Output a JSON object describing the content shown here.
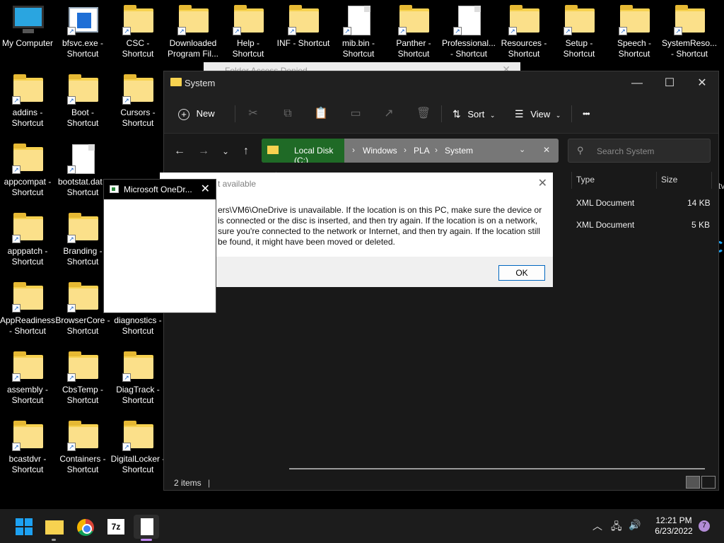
{
  "desktop": {
    "icons": [
      {
        "label": "My Computer",
        "type": "monitor"
      },
      {
        "label": "bfsvc.exe - Shortcut",
        "type": "exe"
      },
      {
        "label": "CSC - Shortcut",
        "type": "folder"
      },
      {
        "label": "Downloaded Program Fil...",
        "type": "folder"
      },
      {
        "label": "Help - Shortcut",
        "type": "folder"
      },
      {
        "label": "INF - Shortcut",
        "type": "folder"
      },
      {
        "label": "mib.bin - Shortcut",
        "type": "doc"
      },
      {
        "label": "Panther - Shortcut",
        "type": "folder"
      },
      {
        "label": "Professional... - Shortcut",
        "type": "doc"
      },
      {
        "label": "Resources - Shortcut",
        "type": "folder"
      },
      {
        "label": "Setup - Shortcut",
        "type": "folder"
      },
      {
        "label": "Speech - Shortcut",
        "type": "folder"
      },
      {
        "label": "SystemReso... - Shortcut",
        "type": "folder"
      },
      {
        "label": "addins - Shortcut",
        "type": "folder"
      },
      {
        "label": "Boot - Shortcut",
        "type": "folder"
      },
      {
        "label": "Cursors - Shortcut",
        "type": "folder"
      },
      {
        "label": "appcompat - Shortcut",
        "type": "folder"
      },
      {
        "label": "bootstat.dat - Shortcut",
        "type": "doc"
      },
      {
        "label": "apppatch - Shortcut",
        "type": "folder"
      },
      {
        "label": "Branding - Shortcut",
        "type": "folder"
      },
      {
        "label": "AppReadiness - Shortcut",
        "type": "folder"
      },
      {
        "label": "BrowserCore - Shortcut",
        "type": "folder"
      },
      {
        "label": "diagnostics - Shortcut",
        "type": "folder"
      },
      {
        "label": "assembly - Shortcut",
        "type": "folder"
      },
      {
        "label": "CbsTemp - Shortcut",
        "type": "folder"
      },
      {
        "label": "DiagTrack - Shortcut",
        "type": "folder"
      },
      {
        "label": "bcastdvr - Shortcut",
        "type": "folder"
      },
      {
        "label": "Containers - Shortcut",
        "type": "folder"
      },
      {
        "label": "DigitalLocker - Shortcut",
        "type": "folder"
      }
    ]
  },
  "explorer": {
    "title": "System",
    "toolbar": {
      "new_label": "New",
      "sort_label": "Sort",
      "view_label": "View",
      "more_label": "•••"
    },
    "breadcrumbs": [
      "Local Disk (C:)",
      "Windows",
      "PLA",
      "System"
    ],
    "search_placeholder": "Search System",
    "columns": {
      "type": "Type",
      "size": "Size"
    },
    "rows": [
      {
        "type": "XML Document",
        "size": "14 KB"
      },
      {
        "type": "XML Document",
        "size": "5 KB"
      }
    ],
    "status": "2 items"
  },
  "ghost_dialog": {
    "title": "Folder Access Denied"
  },
  "error_dialog": {
    "title": "t available",
    "message": "ers\\VM6\\OneDrive is unavailable. If the location is on this PC, make sure the device or is connected or the disc is inserted, and then try again. If the location is on a network, sure you're connected to the network or Internet, and then try again. If the location still be found, it might have been moved or deleted.",
    "ok_label": "OK"
  },
  "onedrive_dialog": {
    "title": "Microsoft OneDr..."
  },
  "side_text": "tv",
  "taskbar": {
    "time": "12:21 PM",
    "date": "6/23/2022",
    "notification_count": "7",
    "sevenzip_label": "7z"
  }
}
